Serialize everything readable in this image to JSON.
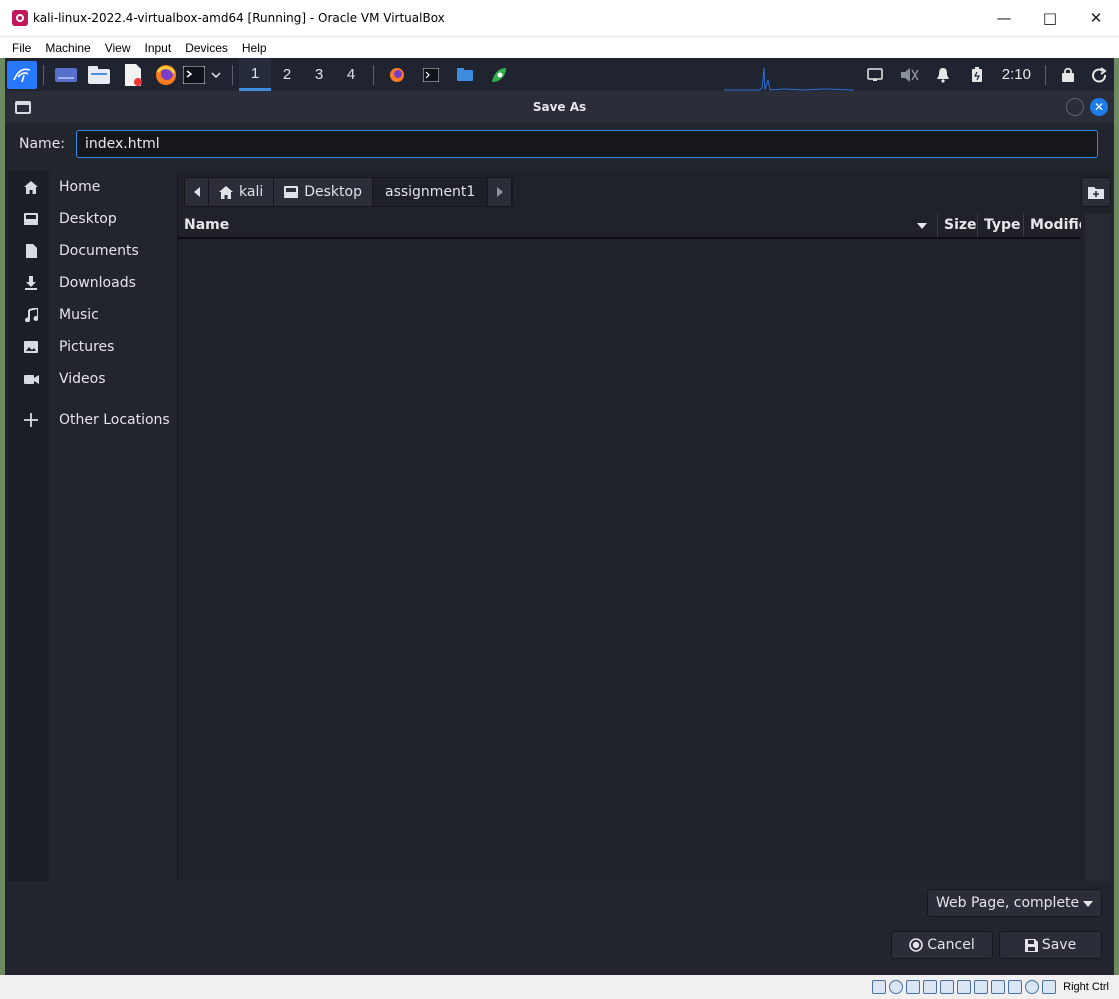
{
  "host_window": {
    "title": "kali-linux-2022.4-virtualbox-amd64 [Running] - Oracle VM VirtualBox",
    "controls": [
      "minimize",
      "maximize",
      "close"
    ]
  },
  "vbox_menu": [
    "File",
    "Machine",
    "View",
    "Input",
    "Devices",
    "Help"
  ],
  "panel": {
    "workspaces": [
      "1",
      "2",
      "3",
      "4"
    ],
    "active_workspace": "1",
    "clock": "2:10",
    "accent": "#2777ff"
  },
  "dialog": {
    "title": "Save As",
    "name_label": "Name:",
    "name_value": "index.html",
    "places": [
      {
        "label": "Home",
        "icon": "home-icon"
      },
      {
        "label": "Desktop",
        "icon": "desktop-icon"
      },
      {
        "label": "Documents",
        "icon": "document-icon"
      },
      {
        "label": "Downloads",
        "icon": "download-icon"
      },
      {
        "label": "Music",
        "icon": "music-icon"
      },
      {
        "label": "Pictures",
        "icon": "picture-icon"
      },
      {
        "label": "Videos",
        "icon": "video-icon"
      },
      {
        "label": "Other Locations",
        "icon": "plus-icon"
      }
    ],
    "breadcrumb": [
      "kali",
      "Desktop",
      "assignment1"
    ],
    "columns": [
      "Name",
      "Size",
      "Type",
      "Modifie"
    ],
    "file_type": "Web Page, complete",
    "cancel_label": "Cancel",
    "save_label": "Save"
  },
  "vbox_status": {
    "host_key": "Right Ctrl"
  }
}
